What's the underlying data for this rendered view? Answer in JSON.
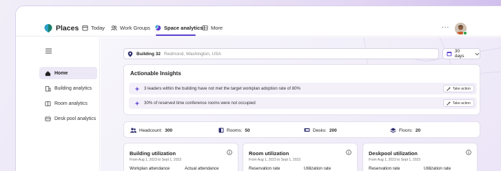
{
  "app": {
    "name": "Places"
  },
  "nav": [
    {
      "label": "Today",
      "icon": "calendar-icon"
    },
    {
      "label": "Work Groups",
      "icon": "people-icon"
    },
    {
      "label": "Space analytics",
      "icon": "pie-chart-icon",
      "active": true
    },
    {
      "label": "More",
      "icon": "grid-icon"
    }
  ],
  "header": {
    "more": "...",
    "avatar": "user-avatar"
  },
  "sidebar": {
    "items": [
      {
        "label": "Home",
        "icon": "home-icon",
        "active": true
      },
      {
        "label": "Building analytics",
        "icon": "building-icon"
      },
      {
        "label": "Room analytics",
        "icon": "room-icon"
      },
      {
        "label": "Desk pool analytics",
        "icon": "desk-icon"
      }
    ]
  },
  "building": {
    "name": "Building 32",
    "location": "Redmond, Washington, USA"
  },
  "range": {
    "label": "30 days"
  },
  "insights": {
    "title": "Actionable Insights",
    "items": [
      {
        "text": "3 leaders within the building have not met the target workplan adoption rate of 80%",
        "action": "Take action"
      },
      {
        "text": "30% of reserved time conference rooms were not occupied",
        "action": "Take action"
      }
    ]
  },
  "stats": [
    {
      "label": "Headcount:",
      "value": "300"
    },
    {
      "label": "Rooms:",
      "value": "50"
    },
    {
      "label": "Desks:",
      "value": "200"
    },
    {
      "label": "Floors:",
      "value": "20"
    }
  ],
  "cards": [
    {
      "title": "Building utilization",
      "subtitle": "From Aug 1, 2023 to Sept 1, 2023",
      "col1": "Workplan attendance",
      "col2": "Actual attendance"
    },
    {
      "title": "Room utilization",
      "subtitle": "From Aug 1, 2023 to Sept 1, 2023",
      "col1": "Reservation rate",
      "col2": "Utilization rate"
    },
    {
      "title": "Deskpool utilization",
      "subtitle": "From Aug 1, 2023 to Sept 1, 2023",
      "col1": "Reservation rate",
      "col2": "Utilization rate"
    }
  ],
  "colors": {
    "accent": "#5b3fd1",
    "brand_logo": "#2aa0c8"
  }
}
